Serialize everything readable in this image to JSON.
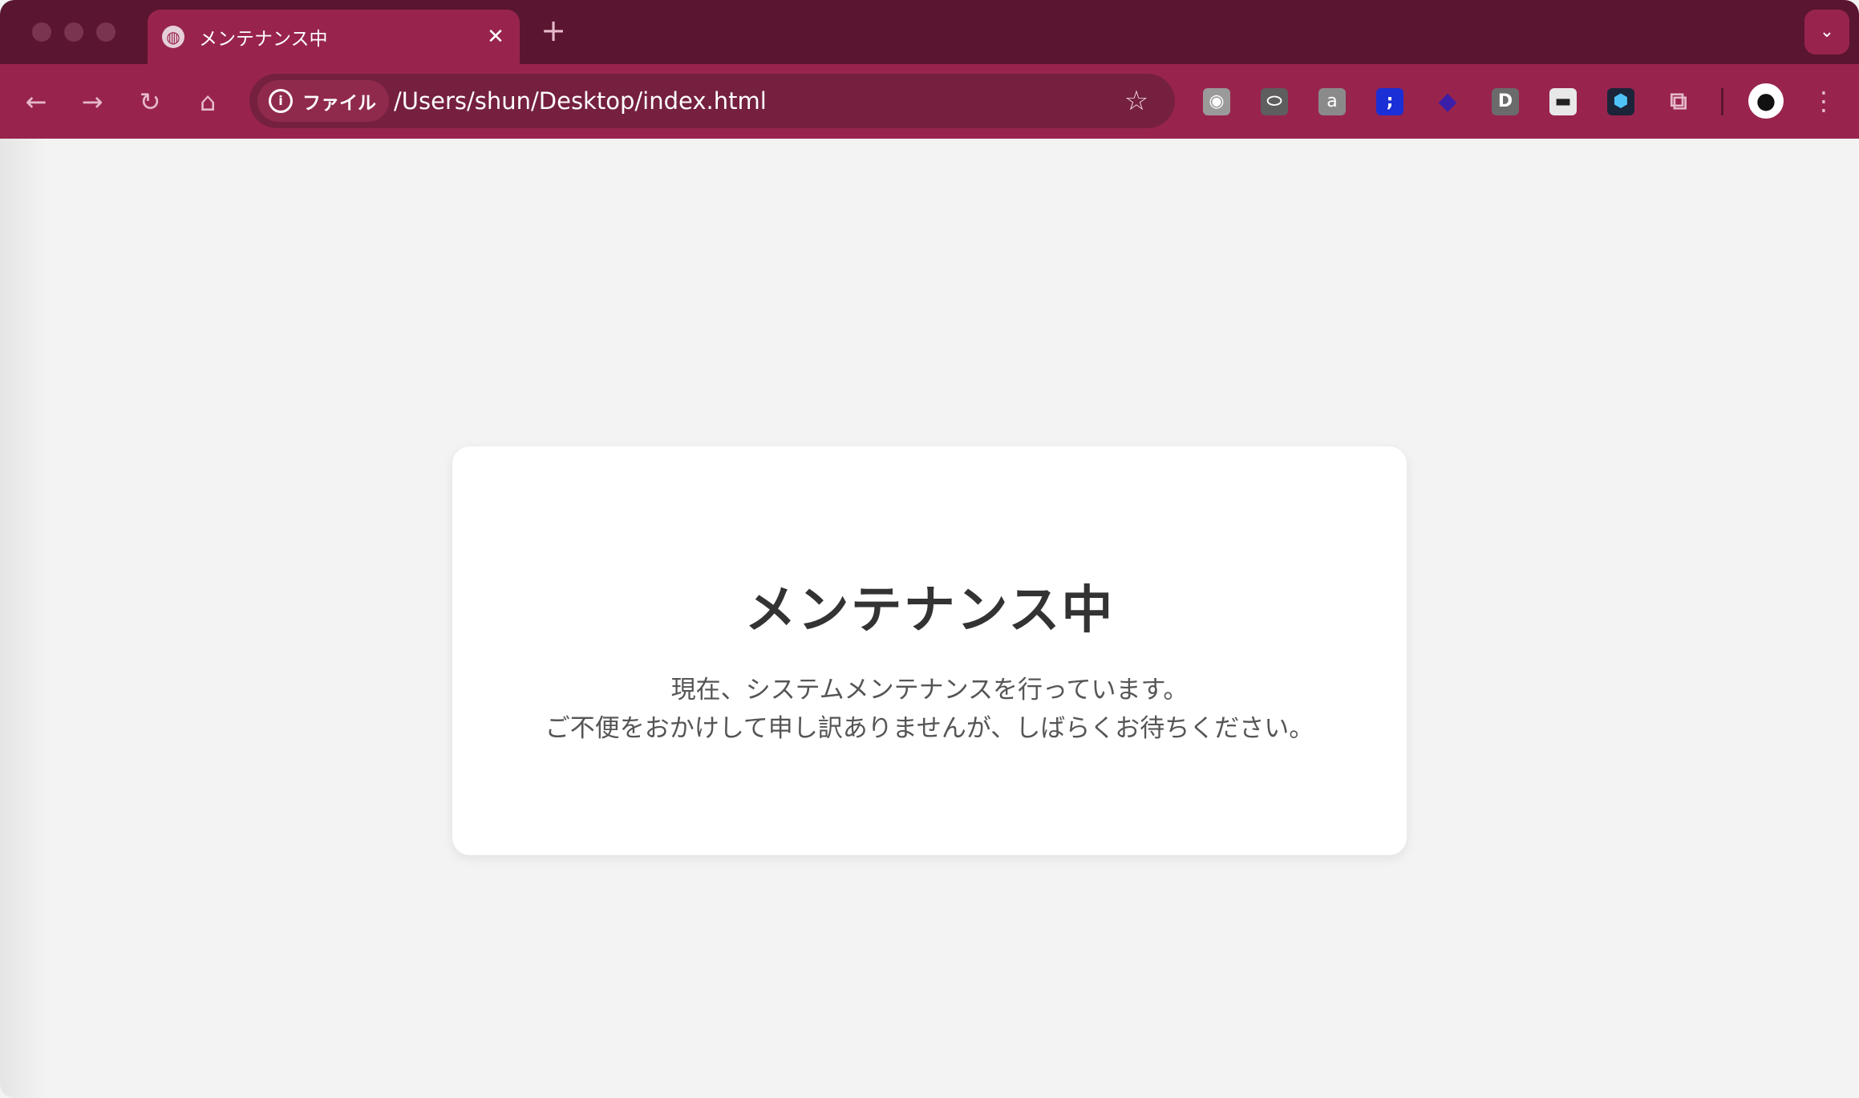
{
  "browser": {
    "tab": {
      "title": "メンテナンス中",
      "favicon": "globe-icon",
      "close": "✕"
    },
    "new_tab": "+",
    "tab_search": "⌄",
    "nav": {
      "back": "←",
      "forward": "→",
      "reload": "↻",
      "home": "⌂"
    },
    "omnibox": {
      "chip_label": "ファイル",
      "info_icon": "i",
      "url": "/Users/shun/Desktop/index.html",
      "bookmark_icon": "☆"
    },
    "extensions": [
      {
        "name": "rss-extension-icon",
        "glyph": "◉",
        "color": "#9a9a9a"
      },
      {
        "name": "game-extension-icon",
        "glyph": "⬭",
        "color": "#5e5e5e"
      },
      {
        "name": "a-extension-icon",
        "glyph": "a",
        "color": "#8a8a8a"
      },
      {
        "name": "semicolon-extension-icon",
        "glyph": ";",
        "color": "#1a2fd6"
      },
      {
        "name": "layers-extension-icon",
        "glyph": "◆",
        "color": "#3b1fa8"
      },
      {
        "name": "d-extension-icon",
        "glyph": "D",
        "color": "#6b6b6b"
      },
      {
        "name": "mask-extension-icon",
        "glyph": "▬",
        "color": "#e8e8e8"
      },
      {
        "name": "hexagon-extension-icon",
        "glyph": "⬢",
        "color": "#1b2438"
      },
      {
        "name": "puzzle-extension-icon",
        "glyph": "⧉",
        "color": "#98244e"
      }
    ],
    "profile_icon": "github-icon",
    "menu": "⋮"
  },
  "page": {
    "heading": "メンテナンス中",
    "message_line1": "現在、システムメンテナンスを行っています。",
    "message_line2": "ご不便をおかけして申し訳ありませんが、しばらくお待ちください。"
  },
  "colors": {
    "tabstrip": "#5a1530",
    "toolbar": "#98244e",
    "page_bg": "#f3f3f3"
  }
}
